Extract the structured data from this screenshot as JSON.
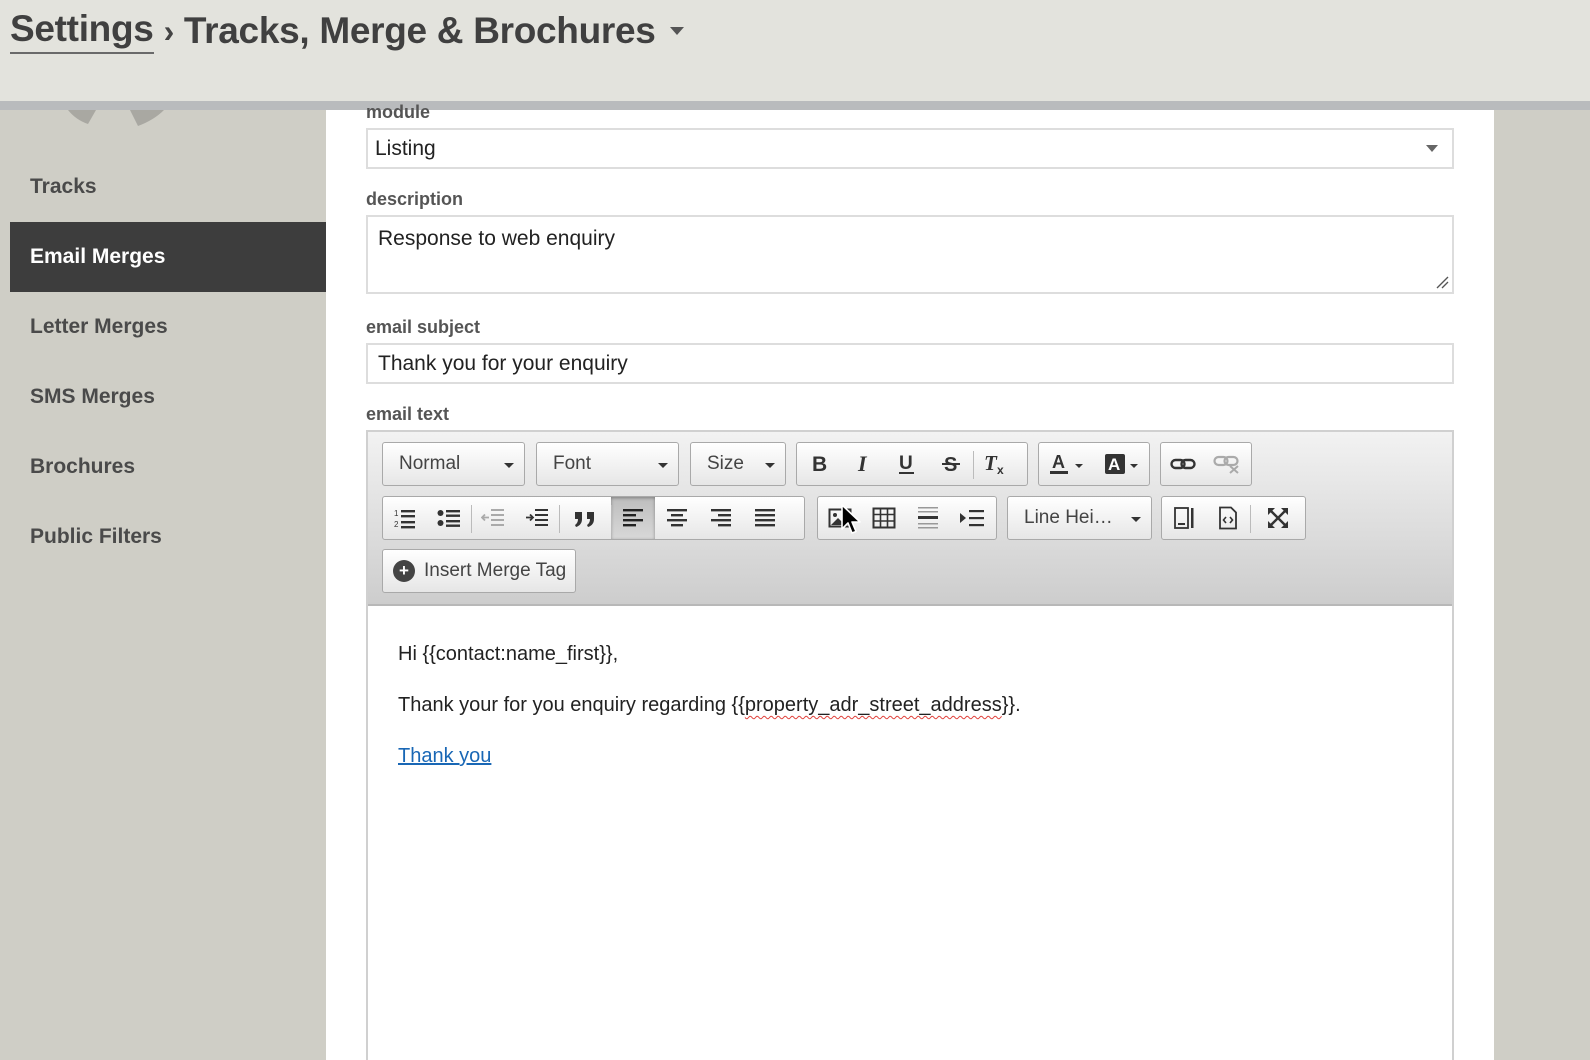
{
  "breadcrumb": {
    "root": "Settings",
    "separator": "›",
    "current": "Tracks, Merge & Brochures"
  },
  "sidebar": {
    "items": [
      {
        "label": "Tracks",
        "active": false
      },
      {
        "label": "Email Merges",
        "active": true
      },
      {
        "label": "Letter Merges",
        "active": false
      },
      {
        "label": "SMS Merges",
        "active": false
      },
      {
        "label": "Brochures",
        "active": false
      },
      {
        "label": "Public Filters",
        "active": false
      }
    ]
  },
  "form": {
    "module_label": "module",
    "module_value": "Listing",
    "description_label": "description",
    "description_value": "Response to web enquiry",
    "subject_label": "email subject",
    "subject_value": "Thank you for your enquiry",
    "email_text_label": "email text"
  },
  "editor": {
    "format_combo": "Normal",
    "font_combo": "Font",
    "size_combo": "Size",
    "line_height_combo": "Line Hei…",
    "insert_merge_tag": "Insert Merge Tag",
    "active_button": "align-left",
    "body": {
      "line1": "Hi {{contact:name_first}},",
      "line2_prefix": "Thank your for you enquiry regarding {{",
      "line2_flagged": "property_adr_street_address",
      "line2_suffix": "}}.",
      "link_text": "Thank you"
    }
  },
  "colors": {
    "header_bg": "#e3e3dd",
    "sidebar_bg": "#cfcec6",
    "sidebar_active_bg": "#3d3d3d",
    "link": "#1967b5",
    "spellcheck": "#e0403a"
  }
}
